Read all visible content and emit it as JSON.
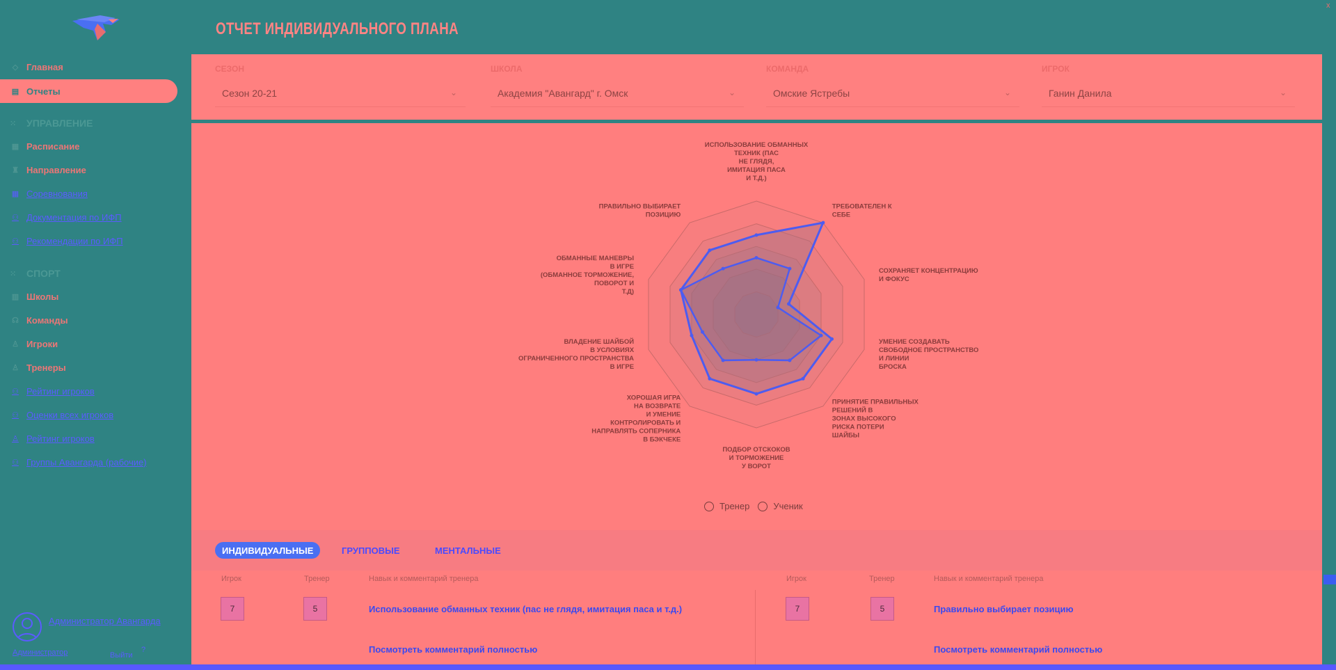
{
  "sidebar": {
    "items": [
      {
        "label": "Главная",
        "icon": "shield-icon"
      },
      {
        "label": "Отчеты",
        "icon": "document-icon"
      }
    ],
    "section_manage": "УПРАВЛЕНИЕ",
    "manage_items": [
      {
        "label": "Расписание",
        "icon": "grid-icon"
      },
      {
        "label": "Направление",
        "icon": "trophy-icon"
      },
      {
        "label": "Соревнования",
        "icon": "grid-icon"
      },
      {
        "label": "Документация по ИФП",
        "icon": "users-icon"
      },
      {
        "label": "Рекомендации по ИФП",
        "icon": "users-icon"
      }
    ],
    "section_sport": "СПОРТ",
    "sport_items": [
      {
        "label": "Школы",
        "icon": "school-icon"
      },
      {
        "label": "Команды",
        "icon": "team-icon"
      },
      {
        "label": "Игроки",
        "icon": "person-icon"
      },
      {
        "label": "Тренеры",
        "icon": "person-icon"
      },
      {
        "label": "Рейтинг игроков",
        "icon": "users-icon"
      },
      {
        "label": "Оценки всех игроков",
        "icon": "users-icon"
      },
      {
        "label": "Рейтинг игроков",
        "icon": "person-icon"
      },
      {
        "label": "Группы Авангарда (рабочие)",
        "icon": "users-icon"
      }
    ],
    "user": {
      "name": "Администратор Авангарда",
      "role": "Администратор",
      "exit": "Выйти",
      "q": "?"
    }
  },
  "page_title": "ОТЧЕТ ИНДИВИДУАЛЬНОГО ПЛАНА",
  "filters": {
    "season_label": "СЕЗОН",
    "season_value": "Сезон 20-21",
    "school_label": "ШКОЛА",
    "school_value": "Академия \"Авангард\" г. Омск",
    "team_label": "КОМАНДА",
    "team_value": "Омские Ястребы",
    "player_label": "ИГРОК",
    "player_value": "Ганин Данила"
  },
  "chart_data": {
    "type": "radar",
    "axes": [
      "ИСПОЛЬЗОВАНИЕ ОБМАННЫХ ТЕХНИК (ПАС НЕ ГЛЯДЯ, ИМИТАЦИЯ ПАСА И Т.Д.)",
      "ТРЕБОВАТЕЛЕН К СЕБЕ",
      "СОХРАНЯЕТ КОНЦЕНТРАЦИЮ И ФОКУС",
      "УМЕНИЕ СОЗДАВАТЬ СВОБОДНОЕ ПРОСТРАНСТВО И ЛИНИИ БРОСКА",
      "ПРИНЯТИЕ ПРАВИЛЬНЫХ РЕШЕНИЙ В ЗОНАХ ВЫСОКОГО РИСКА ПОТЕРИ ШАЙБЫ",
      "ПОДБОР ОТСКОКОВ И ТОРМОЖЕНИЕ У ВОРОТ",
      "ХОРОШАЯ ИГРА НА ВОЗВРАТЕ И УМЕНИЕ КОНТРОЛИРОВАТЬ И НАПРАВЛЯТЬ СОПЕРНИКА В БЭКЧЕКЕ",
      "ВЛАДЕНИЕ ШАЙБОЙ В УСЛОВИЯХ ОГРАНИЧЕННОГО ПРОСТРАНСТВА В ИГРЕ",
      "ОБМАННЫЕ МАНЕВРЫ В ИГРЕ (ОБМАННОЕ ТОРМОЖЕНИЕ, ПОВОРОТ И Т.Д)",
      "ПРАВИЛЬНО ВЫБИРАЕТ ПОЗИЦИЮ"
    ],
    "axis_label_lines": [
      [
        "ИСПОЛЬЗОВАНИЕ ОБМАННЫХ",
        "ТЕХНИК (ПАС",
        "НЕ ГЛЯДЯ,",
        "ИМИТАЦИЯ ПАСА",
        "И Т.Д.)"
      ],
      [
        "ТРЕБОВАТЕЛЕН К",
        "СЕБЕ"
      ],
      [
        "СОХРАНЯЕТ КОНЦЕНТРАЦИЮ",
        "И ФОКУС"
      ],
      [
        "УМЕНИЕ СОЗДАВАТЬ",
        "СВОБОДНОЕ ПРОСТРАНСТВО",
        "И ЛИНИИ",
        "БРОСКА"
      ],
      [
        "ПРИНЯТИЕ ПРАВИЛЬНЫХ",
        "РЕШЕНИЙ В",
        "ЗОНАХ ВЫСОКОГО",
        "РИСКА ПОТЕРИ",
        "ШАЙБЫ"
      ],
      [
        "ПОДБОР ОТСКОКОВ",
        "И ТОРМОЖЕНИЕ",
        "У ВОРОТ"
      ],
      [
        "ХОРОШАЯ ИГРА",
        "НА ВОЗВРАТЕ",
        "И УМЕНИЕ",
        "КОНТРОЛИРОВАТЬ И",
        "НАПРАВЛЯТЬ СОПЕРНИКА",
        "В БЭКЧЕКЕ"
      ],
      [
        "ВЛАДЕНИЕ ШАЙБОЙ",
        "В УСЛОВИЯХ",
        "ОГРАНИЧЕННОГО ПРОСТРАНСТВА",
        "В ИГРЕ"
      ],
      [
        "ОБМАННЫЕ МАНЕВРЫ",
        "В ИГРЕ",
        "(ОБМАННОЕ ТОРМОЖЕНИЕ,",
        "ПОВОРОТ И",
        "Т.Д)"
      ],
      [
        "ПРАВИЛЬНО ВЫБИРАЕТ",
        "ПОЗИЦИЮ"
      ]
    ],
    "rmax": 10,
    "grid_levels": [
      2,
      4,
      6,
      8,
      10
    ],
    "series": [
      {
        "name": "Ученик",
        "values": [
          7,
          10,
          3,
          7,
          7,
          7,
          7,
          6,
          7,
          7
        ]
      },
      {
        "name": "Тренер",
        "values": [
          5,
          5,
          2,
          6,
          5,
          4,
          5,
          5,
          7,
          5
        ]
      }
    ],
    "colors": {
      "series": "#4d5cf0",
      "grid": "#c96a6a",
      "fill": "#a57a86"
    }
  },
  "legend": {
    "coach": "Тренер",
    "student": "Ученик"
  },
  "tabs": [
    {
      "label": "ИНДИВИДУАЛЬНЫЕ"
    },
    {
      "label": "ГРУППОВЫЕ"
    },
    {
      "label": "МЕНТАЛЬНЫЕ"
    }
  ],
  "table": {
    "headers": {
      "player": "Игрок",
      "coach": "Тренер",
      "skill": "Навык и комментарий тренера"
    },
    "rows": [
      {
        "player": "7",
        "coach": "5",
        "skill": "Использование обманных техник (пас не глядя, имитация паса и т.д.)",
        "more": "Посмотреть комментарий полностью"
      },
      {
        "player": "7",
        "coach": "5",
        "skill": "Правильно выбирает позицию",
        "more": "Посмотреть комментарий полностью"
      }
    ]
  },
  "window": {
    "close": "x"
  }
}
